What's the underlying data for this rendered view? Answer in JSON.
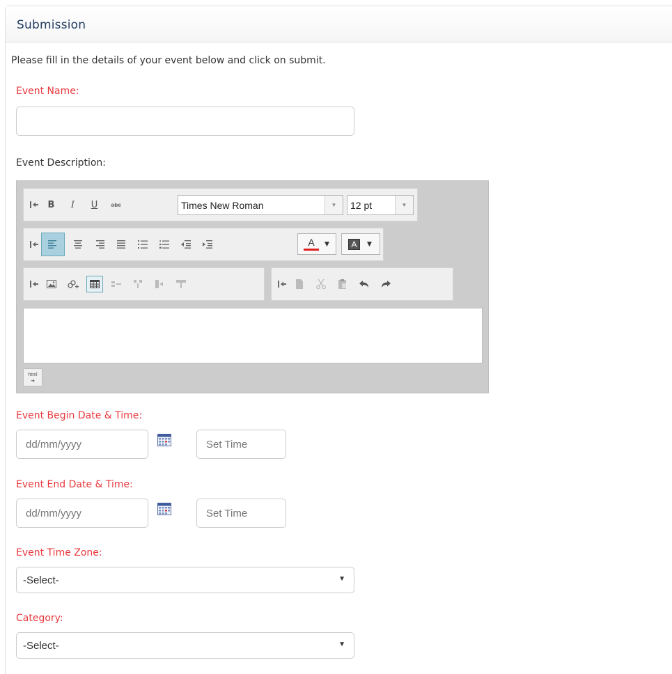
{
  "panel": {
    "title": "Submission"
  },
  "intro": "Please fill in the details of your event below and click on submit.",
  "event_name": {
    "label": "Event Name:",
    "value": ""
  },
  "event_description": {
    "label": "Event Description:",
    "font_family": "Times New Roman",
    "font_size": "12 pt",
    "html_toggle_label": "html"
  },
  "begin": {
    "label": "Event Begin Date & Time:",
    "date_placeholder": "dd/mm/yyyy",
    "time_placeholder": "Set Time"
  },
  "end": {
    "label": "Event End Date & Time:",
    "date_placeholder": "dd/mm/yyyy",
    "time_placeholder": "Set Time"
  },
  "time_zone": {
    "label": "Event Time Zone:",
    "selected": "-Select-"
  },
  "category": {
    "label": "Category:",
    "selected": "-Select-"
  },
  "colors": {
    "required_label": "#e8383d",
    "title": "#1e3a5f",
    "active_button": "#a8d0de"
  }
}
